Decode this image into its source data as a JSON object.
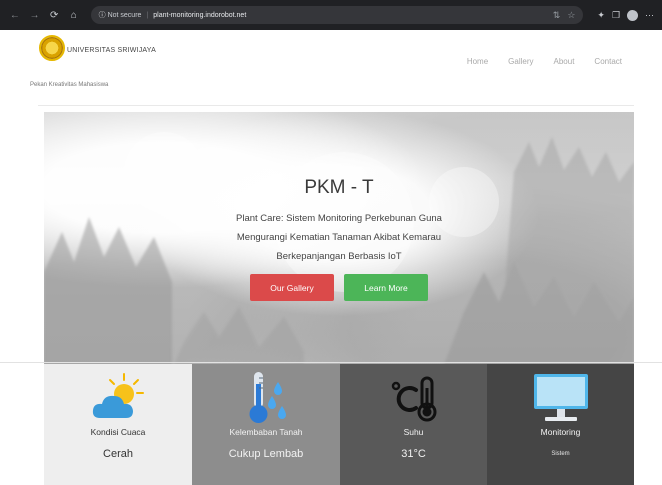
{
  "browser": {
    "security_label": "Not secure",
    "url": "plant-monitoring.indorobot.net"
  },
  "header": {
    "university": "UNIVERSITAS SRIWIJAYA",
    "subtitle": "Pekan Kreativitas Mahasiswa",
    "nav": [
      "Home",
      "Gallery",
      "About",
      "Contact"
    ]
  },
  "hero": {
    "title": "PKM - T",
    "description": "Plant Care: Sistem Monitoring Perkebunan Guna Mengurangi Kematian Tanaman Akibat Kemarau Berkepanjangan Berbasis IoT",
    "buttons": {
      "gallery": "Our Gallery",
      "learn_more": "Learn More"
    }
  },
  "cards": [
    {
      "label": "Kondisi Cuaca",
      "value": "Cerah",
      "icon": "partly-cloudy-icon"
    },
    {
      "label": "Kelembaban Tanah",
      "value": "Cukup Lembab",
      "icon": "soil-moisture-thermometer-icon"
    },
    {
      "label": "Suhu",
      "value": "31°C",
      "icon": "temperature-celsius-icon"
    },
    {
      "label": "Monitoring",
      "value": "Sistem",
      "icon": "monitor-icon"
    }
  ],
  "colors": {
    "gallery_button": "#db4a4a",
    "learn_button": "#4cb558"
  }
}
